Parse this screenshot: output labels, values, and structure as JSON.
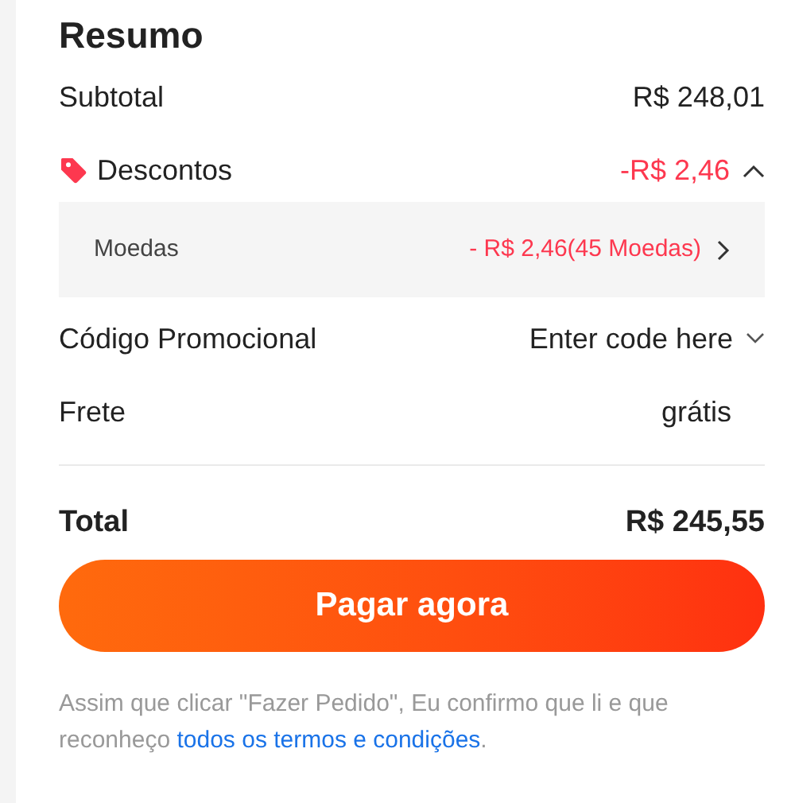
{
  "title": "Resumo",
  "subtotal": {
    "label": "Subtotal",
    "value": "R$ 248,01"
  },
  "discounts": {
    "label": "Descontos",
    "value": "-R$ 2,46",
    "expanded": true,
    "items": [
      {
        "label": "Moedas",
        "value": "- R$ 2,46(45 Moedas)"
      }
    ]
  },
  "promo_code": {
    "label": "Código Promocional",
    "placeholder": "Enter code here"
  },
  "shipping": {
    "label": "Frete",
    "value": "grátis"
  },
  "total": {
    "label": "Total",
    "value": "R$ 245,55"
  },
  "pay_button": "Pagar agora",
  "legal": {
    "text": "Assim que clicar \"Fazer Pedido\", Eu confirmo que li e que reconheço",
    "link": "todos os termos e condições",
    "end": "."
  }
}
